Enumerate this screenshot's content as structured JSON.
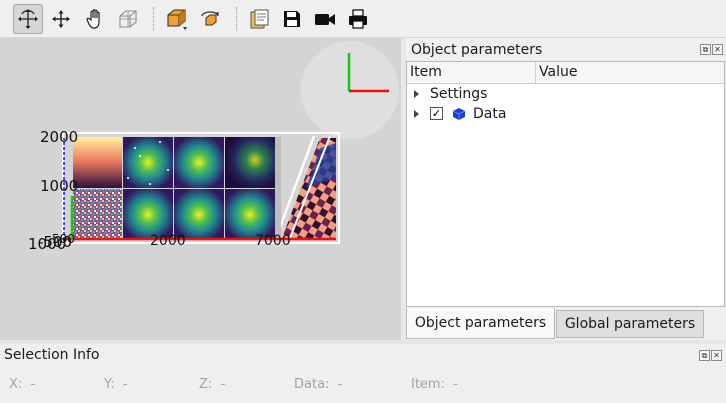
{
  "toolbar": {
    "buttons": [
      {
        "name": "rotate-icon",
        "active": true
      },
      {
        "name": "move-icon",
        "active": false
      },
      {
        "name": "pan-hand-icon",
        "active": false
      },
      {
        "name": "zoom-box-icon",
        "active": false
      },
      {
        "name": "box-view-icon",
        "active": false
      },
      {
        "name": "reset-rotation-icon",
        "active": false
      },
      {
        "name": "copy-clipboard-icon",
        "active": false
      },
      {
        "name": "save-icon",
        "active": false
      },
      {
        "name": "record-video-icon",
        "active": false
      },
      {
        "name": "print-icon",
        "active": false
      }
    ]
  },
  "viewport": {
    "tick_labels": [
      "2000",
      "1000",
      "-500",
      "1000",
      "2000",
      "7000",
      "500"
    ]
  },
  "object_parameters": {
    "title": "Object parameters",
    "columns": [
      "Item",
      "Value"
    ],
    "rows": [
      {
        "label": "Settings",
        "checked": false,
        "has_checkbox": false
      },
      {
        "label": "Data",
        "checked": true,
        "has_checkbox": true,
        "icon": "cube-icon"
      }
    ],
    "checkbox_mark": "✓"
  },
  "tabs": [
    {
      "label": "Object parameters",
      "active": true
    },
    {
      "label": "Global parameters",
      "active": false
    }
  ],
  "selection_info": {
    "title": "Selection Info",
    "fields": [
      {
        "label": "X:",
        "value": "-"
      },
      {
        "label": "Y:",
        "value": "-"
      },
      {
        "label": "Z:",
        "value": "-"
      },
      {
        "label": "Data:",
        "value": "-"
      },
      {
        "label": "Item:",
        "value": "-"
      }
    ]
  },
  "colors": {
    "axis_x": "#ee1111",
    "axis_y": "#11cc11",
    "axis_z": "#1111ee",
    "viewport_bg": "#d4d4d4"
  }
}
